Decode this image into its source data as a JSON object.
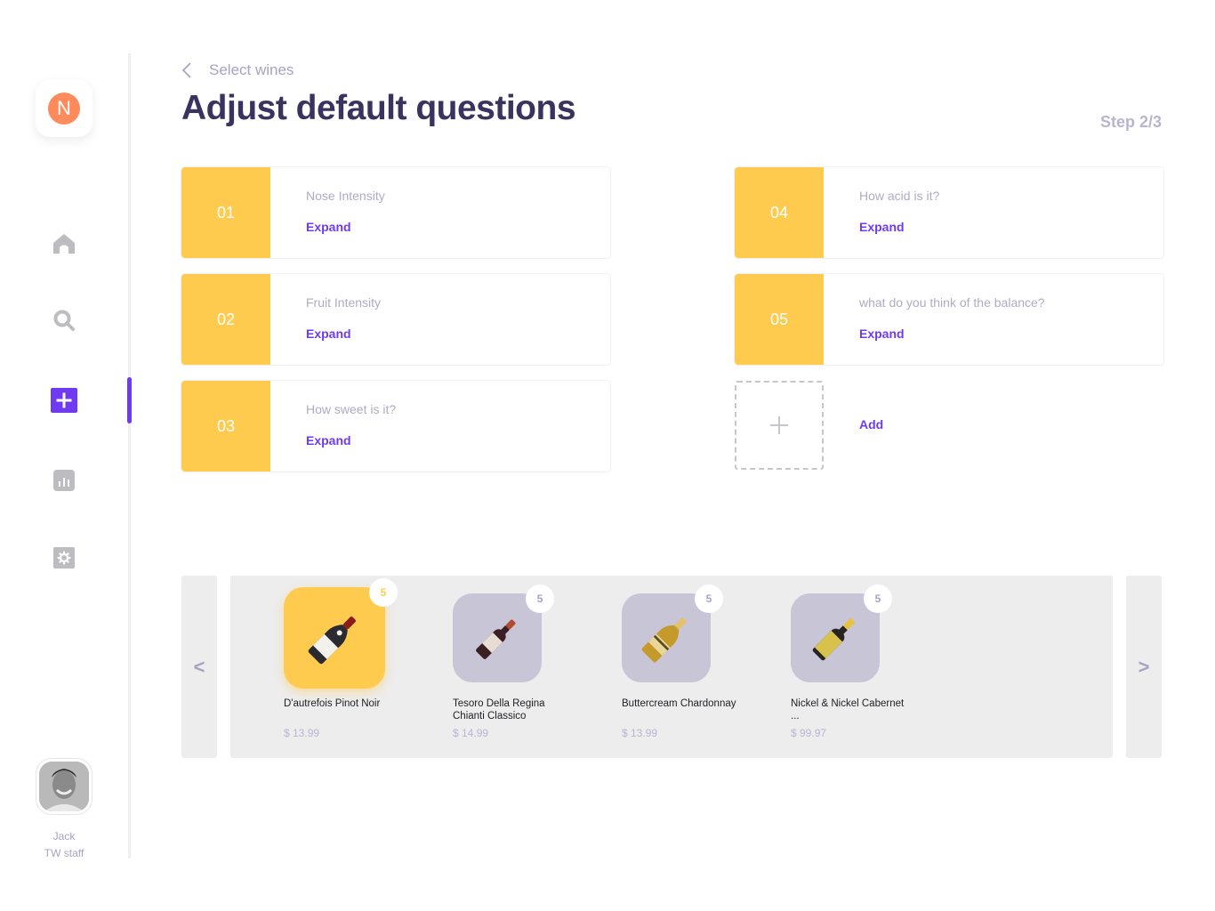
{
  "sidebar": {
    "logo_letter": "N",
    "nav": [
      {
        "id": "home",
        "icon": "home-icon",
        "active": false
      },
      {
        "id": "search",
        "icon": "search-icon",
        "active": false
      },
      {
        "id": "create",
        "icon": "plus-icon",
        "active": true
      },
      {
        "id": "stats",
        "icon": "bar-chart-icon",
        "active": false
      },
      {
        "id": "settings",
        "icon": "gear-icon",
        "active": false
      }
    ],
    "user": {
      "name": "Jack",
      "role": "TW staff"
    }
  },
  "header": {
    "back_label": "Select wines",
    "title": "Adjust default questions",
    "step": "Step 2/3"
  },
  "questions": [
    {
      "number": "01",
      "text": "Nose Intensity",
      "action": "Expand"
    },
    {
      "number": "02",
      "text": "Fruit Intensity",
      "action": "Expand"
    },
    {
      "number": "03",
      "text": "How sweet is it?",
      "action": "Expand"
    },
    {
      "number": "04",
      "text": "How acid is it?",
      "action": "Expand"
    },
    {
      "number": "05",
      "text": "what do you think of the balance?",
      "action": "Expand"
    }
  ],
  "add_question": {
    "label": "Add"
  },
  "carousel": {
    "prev_label": "<",
    "next_label": ">",
    "wines": [
      {
        "name": "D'autrefois Pinot Noir",
        "price": "$ 13.99",
        "badge": "5",
        "selected": true,
        "bottle": "pinot-noir"
      },
      {
        "name": "Tesoro Della Regina Chianti Classico",
        "price": "$ 14.99",
        "badge": "5",
        "selected": false,
        "bottle": "chianti"
      },
      {
        "name": "Buttercream Chardonnay",
        "price": "$ 13.99",
        "badge": "5",
        "selected": false,
        "bottle": "chardonnay"
      },
      {
        "name": "Nickel & Nickel Cabernet ...",
        "price": "$ 99.97",
        "badge": "5",
        "selected": false,
        "bottle": "cabernet"
      }
    ]
  },
  "colors": {
    "accent": "#6e3bf2",
    "card_yellow": "#ffcb4f",
    "logo_orange": "#ff8a5c",
    "muted_text": "#a7a3c2",
    "title_text": "#3a3360"
  }
}
